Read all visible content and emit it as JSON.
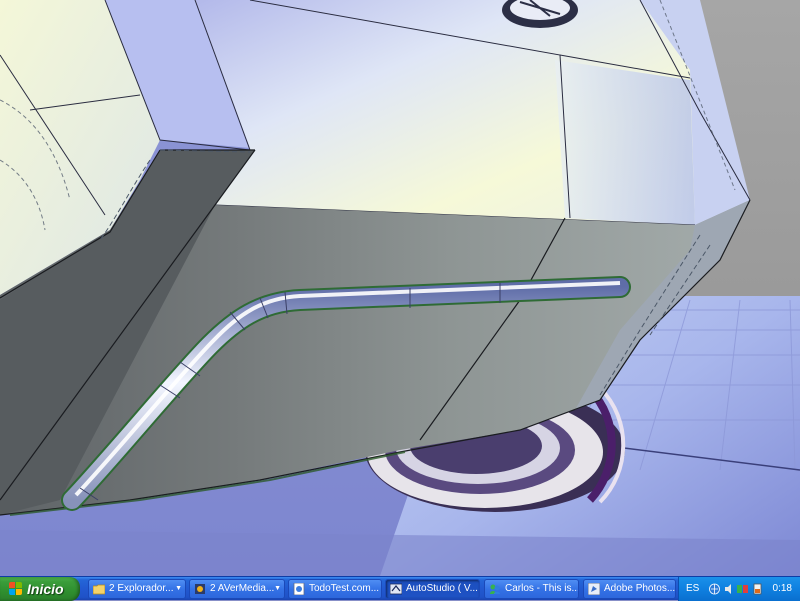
{
  "start_button": {
    "label": "Inicio"
  },
  "taskbar_items": [
    {
      "label": "2 Explorador...",
      "icon": "folder-icon",
      "grouped": true,
      "active": false
    },
    {
      "label": "2 AVerMedia...",
      "icon": "avermedia-icon",
      "grouped": true,
      "active": false
    },
    {
      "label": "TodoTest.com...",
      "icon": "web-page-icon",
      "grouped": false,
      "active": false
    },
    {
      "label": "AutoStudio ( V...",
      "icon": "autostudio-icon",
      "grouped": false,
      "active": true
    },
    {
      "label": "Carlos - This is...",
      "icon": "messenger-icon",
      "grouped": false,
      "active": false
    },
    {
      "label": "Adobe Photos...",
      "icon": "photoshop-icon",
      "grouped": false,
      "active": false
    }
  ],
  "tray": {
    "language": "ES",
    "icons": [
      "network-icon",
      "volume-icon",
      "app-tray-icon",
      "battery-icon"
    ],
    "clock": "0:18"
  },
  "viewport": {
    "description_icon": "3d-viewport"
  }
}
